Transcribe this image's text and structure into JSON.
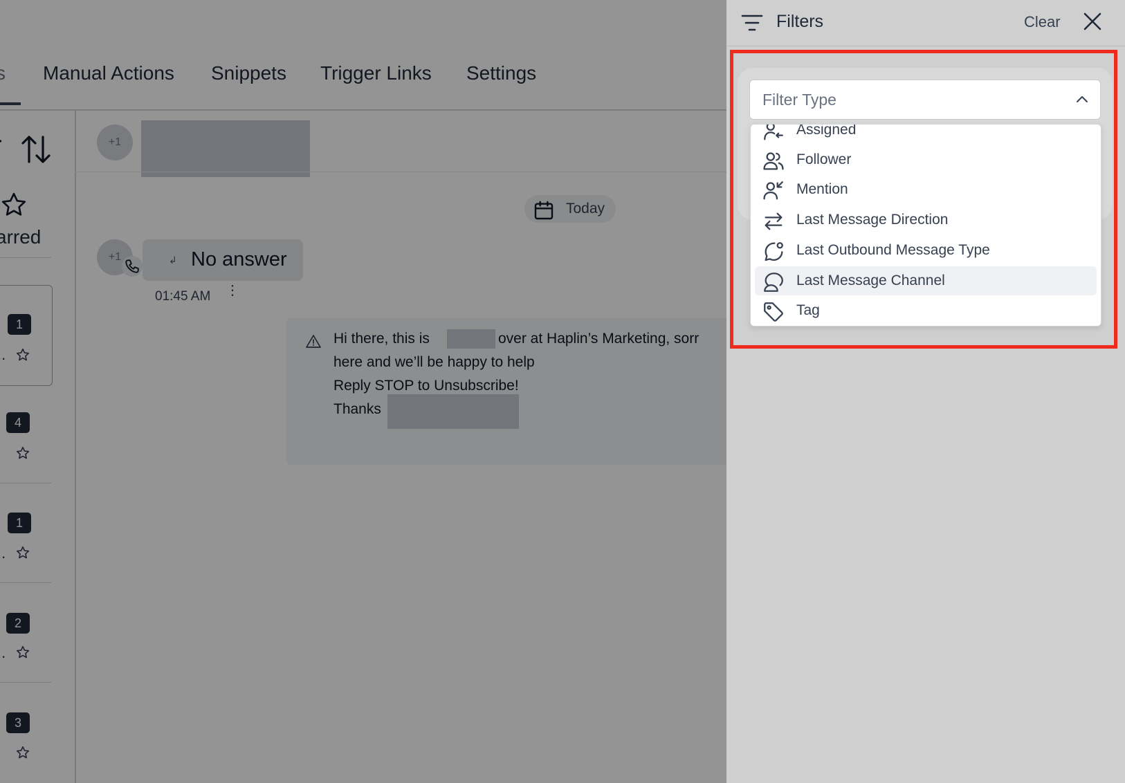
{
  "tabs": {
    "partial": "s",
    "items": [
      {
        "label": "Manual Actions"
      },
      {
        "label": "Snippets"
      },
      {
        "label": "Trigger Links"
      },
      {
        "label": "Settings"
      }
    ]
  },
  "sidebar": {
    "starred_label": "arred",
    "conversations": [
      {
        "unread": "1",
        "ellipsis": ".."
      },
      {
        "unread": "4",
        "ellipsis": ""
      },
      {
        "unread": "1",
        "ellipsis": ".."
      },
      {
        "unread": "2",
        "ellipsis": ".."
      },
      {
        "unread": "3",
        "ellipsis": ""
      }
    ]
  },
  "conversation": {
    "header_avatar": "+1",
    "date_chip": "Today",
    "call": {
      "avatar": "+1",
      "status": "No answer",
      "time": "01:45 AM"
    },
    "outbound_lines": [
      "Hi there, this is",
      "over at Haplin’s Marketing, sorr",
      "here and we’ll be happy to help",
      "Reply STOP to Unsubscribe!",
      "Thanks"
    ]
  },
  "filters": {
    "title": "Filters",
    "clear_label": "Clear",
    "select_placeholder": "Filter Type",
    "options": [
      {
        "label": "Assigned",
        "icon": "assigned-icon"
      },
      {
        "label": "Follower",
        "icon": "follower-icon"
      },
      {
        "label": "Mention",
        "icon": "mention-icon"
      },
      {
        "label": "Last Message Direction",
        "icon": "arrows-direction-icon"
      },
      {
        "label": "Last Outbound Message Type",
        "icon": "message-dot-icon"
      },
      {
        "label": "Last Message Channel",
        "icon": "chat-channel-icon"
      },
      {
        "label": "Tag",
        "icon": "tag-icon"
      }
    ],
    "highlighted": "Last Message Channel"
  },
  "colors": {
    "highlight_frame": "#ef2b1d",
    "panel_bg": "#cfcfcf",
    "badge_bg": "#1f2937"
  }
}
